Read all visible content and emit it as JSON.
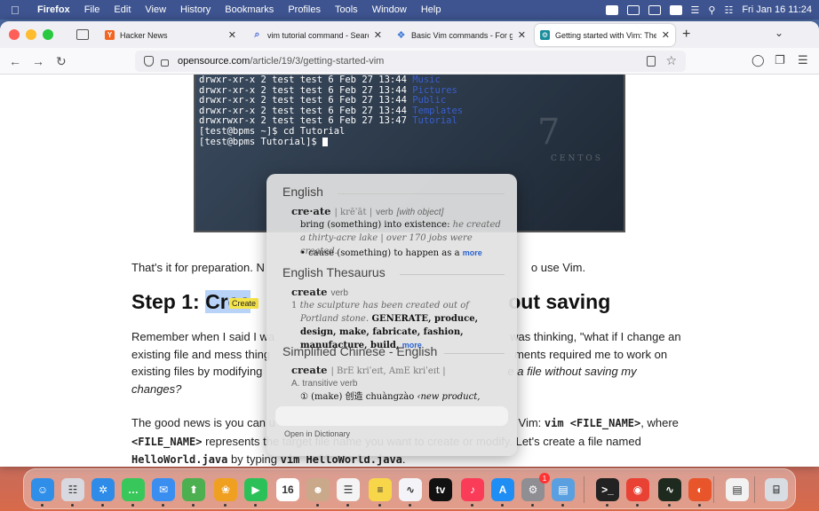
{
  "menubar": {
    "apple": "",
    "app": "Firefox",
    "items": [
      "File",
      "Edit",
      "View",
      "History",
      "Bookmarks",
      "Profiles",
      "Tools",
      "Window",
      "Help"
    ],
    "clock": "Fri Jan 16  11:24"
  },
  "tabs": [
    {
      "title": "Hacker News",
      "fav": "Y",
      "fav_color": "#f26522"
    },
    {
      "title": "vim tutorial command - Search",
      "fav": "⌕",
      "fav_color": "#4a6bd6"
    },
    {
      "title": "Basic Vim commands - For getti",
      "fav": "❖",
      "fav_color": "#3b77d8"
    },
    {
      "title": "Getting started with Vim: The b",
      "fav": "⚙",
      "fav_color": "#1a8c9c"
    }
  ],
  "url": {
    "domain": "opensource.com",
    "path": "/article/19/3/getting-started-vim"
  },
  "terminal": {
    "lines": [
      {
        "text": "drwxr-xr-x 2 test test 6 Feb 27 13:44 ",
        "dir": "Music"
      },
      {
        "text": "drwxr-xr-x 2 test test 6 Feb 27 13:44 ",
        "dir": "Pictures"
      },
      {
        "text": "drwxr-xr-x 2 test test 6 Feb 27 13:44 ",
        "dir": "Public"
      },
      {
        "text": "drwxr-xr-x 2 test test 6 Feb 27 13:44 ",
        "dir": "Templates"
      },
      {
        "text": "drwxrwxr-x 2 test test 6 Feb 27 13:47 ",
        "dir": "Tutorial"
      }
    ],
    "cmd1": "[test@bpms ~]$ cd Tutorial",
    "cmd2": "[test@bpms Tutorial]$ ",
    "watermark_digit": "7",
    "watermark_text": "CENTOS"
  },
  "article": {
    "prep_a": "That's it for preparation. N",
    "prep_b": "o use Vim.",
    "h2_pre": "Step 1: ",
    "h2_hl": "Crea",
    "h2_post": "out saving",
    "tooltip": "Create",
    "p1_a": "Remember when I said I wa",
    "p1_b": "was thinking, \"what if I change an",
    "p2_a": "existing file and mess thing",
    "p2_b": "ments required me to work on",
    "p3_a": "existing files by modifying",
    "p3_b": "e a file without saving my",
    "p4": "changes?",
    "p5_a": "The good news is you can u",
    "p5_b": " Vim: ",
    "p5_code1": "vim <FILE_NAME>",
    "p5_c": ", where",
    "p6_code": "<FILE_NAME>",
    "p6_a": " represents the target file name you want to create or modify. Let's create a file named",
    "p7_code1": "HelloWorld.java",
    "p7_a": " by typing ",
    "p7_code2": "vim HelloWorld.java",
    "p7_b": "."
  },
  "dictionary": {
    "sec1": "English",
    "hw1": "cre·ate",
    "pron1": "| krēˈāt |",
    "pos1": "verb",
    "posnote1": "[with object]",
    "def1a": "bring (something) into existence: ",
    "ex1a": "he created a thirty-acre lake | over 170 jobs were created.",
    "def1b": "• cause (something) to happen as a ",
    "more": "more",
    "sec2": "English Thesaurus",
    "hw2": "create",
    "pos2": "verb",
    "num2": "1",
    "ex2": "the sculpture has been created out of Portland stone.",
    "syn2": " GENERATE, produce, design, make, fabricate, fashion, manufacture, build, ",
    "sec3": "Simplified Chinese - English",
    "hw3": "create",
    "pron3": "| BrE kriˈeɪt, AmE kriˈeɪt |",
    "pos3label": "A.",
    "pos3": "transitive verb",
    "sense3": "① (make) 创造 chuàngzào",
    "ex3": "‹new product,",
    "open": "Open in Dictionary"
  },
  "dock": [
    {
      "name": "finder-icon",
      "glyph": "☺",
      "color": "#2f8fe8"
    },
    {
      "name": "launchpad-icon",
      "glyph": "☷",
      "color": "#d8d8e0"
    },
    {
      "name": "safari-icon",
      "glyph": "✲",
      "color": "#2e8ce8"
    },
    {
      "name": "messages-icon",
      "glyph": "…",
      "color": "#38c75a"
    },
    {
      "name": "mail-icon",
      "glyph": "✉",
      "color": "#3a8ef0"
    },
    {
      "name": "maps-icon",
      "glyph": "⬆",
      "color": "#4caf50"
    },
    {
      "name": "photos-icon",
      "glyph": "❀",
      "color": "#f0a020"
    },
    {
      "name": "facetime-icon",
      "glyph": "▶",
      "color": "#2cc158"
    },
    {
      "name": "calendar-icon",
      "glyph": "16",
      "color": "#ffffff"
    },
    {
      "name": "contacts-icon",
      "glyph": "☻",
      "color": "#c9a98a"
    },
    {
      "name": "reminders-icon",
      "glyph": "☰",
      "color": "#f4f4f4"
    },
    {
      "name": "notes-icon",
      "glyph": "≡",
      "color": "#f7d64a"
    },
    {
      "name": "freeform-icon",
      "glyph": "∿",
      "color": "#f4f4f8"
    },
    {
      "name": "tv-icon",
      "glyph": "tv",
      "color": "#111111"
    },
    {
      "name": "music-icon",
      "glyph": "♪",
      "color": "#fa3c58"
    },
    {
      "name": "appstore-icon",
      "glyph": "A",
      "color": "#1e8ef4"
    },
    {
      "name": "settings-icon",
      "glyph": "⚙",
      "color": "#8e8e93"
    },
    {
      "name": "preview-icon",
      "glyph": "▤",
      "color": "#5aa0e0"
    },
    {
      "name": "terminal-icon",
      "glyph": ">_",
      "color": "#222222"
    },
    {
      "name": "chrome-icon",
      "glyph": "◉",
      "color": "#e94235"
    },
    {
      "name": "activity-monitor-icon",
      "glyph": "∿",
      "color": "#1e2a1e"
    },
    {
      "name": "firefox-icon",
      "glyph": "◐",
      "color": "#e8552a"
    },
    {
      "name": "document-icon",
      "glyph": "▤",
      "color": "#f2f2f2"
    },
    {
      "name": "trash-icon",
      "glyph": "⌸",
      "color": "#d8dde4"
    }
  ],
  "dock_badge": "1"
}
